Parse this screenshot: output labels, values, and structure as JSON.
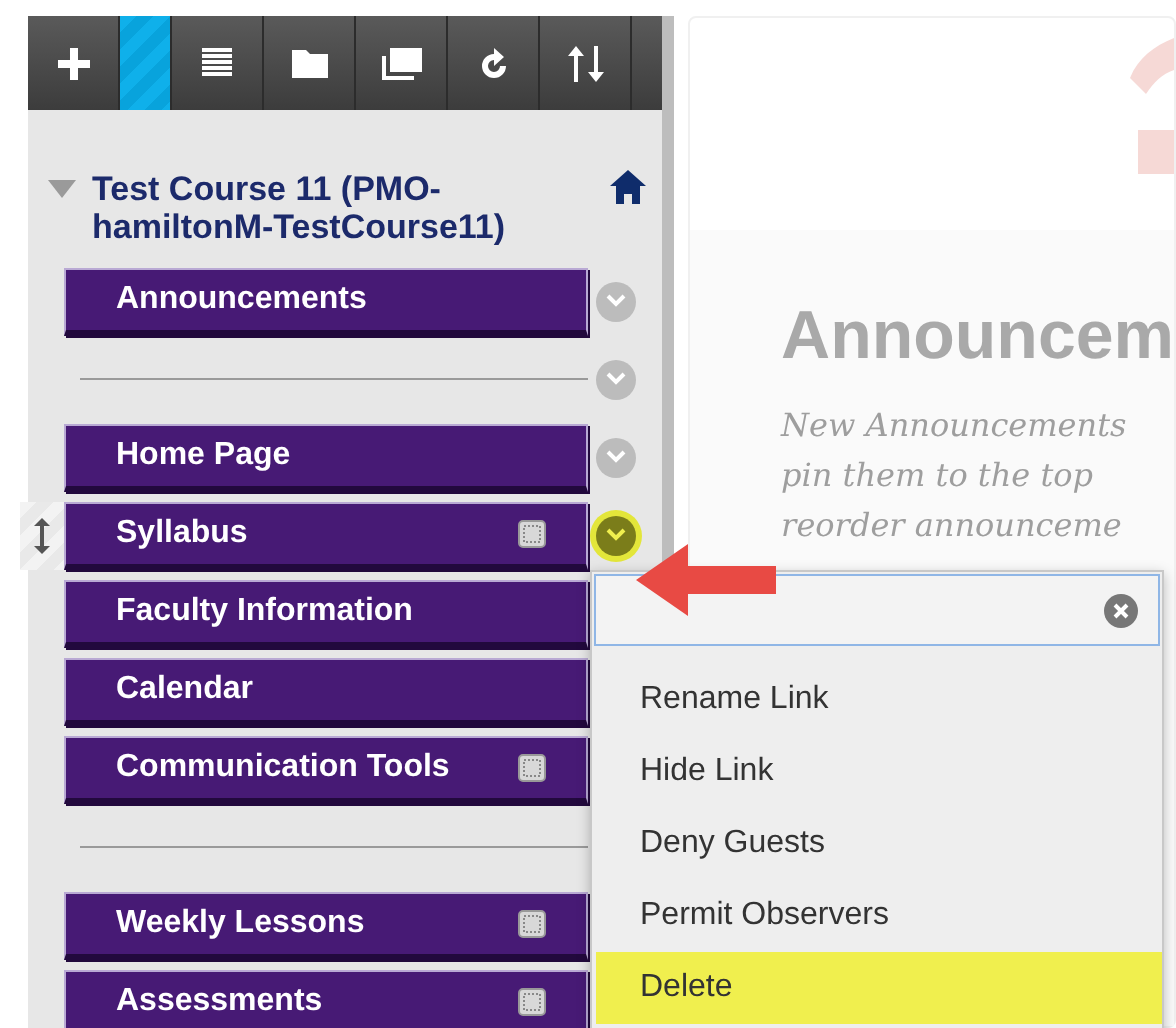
{
  "toolbar": [
    {
      "kind": "add",
      "selected": false
    },
    {
      "kind": "blank",
      "selected": true
    },
    {
      "kind": "list",
      "selected": false
    },
    {
      "kind": "folder",
      "selected": false
    },
    {
      "kind": "window",
      "selected": false
    },
    {
      "kind": "refresh",
      "selected": false
    },
    {
      "kind": "sort",
      "selected": false
    }
  ],
  "course": {
    "title": "Test Course 11 (PMO-hamiltonM-TestCourse11)",
    "expanded": true
  },
  "menu": [
    {
      "kind": "link",
      "label": "Announcements",
      "page_icon": false,
      "options_button": true,
      "active": false
    },
    {
      "kind": "divider",
      "options_button": true
    },
    {
      "kind": "link",
      "label": "Home Page",
      "page_icon": false,
      "options_button": true,
      "active": false
    },
    {
      "kind": "link",
      "label": "Syllabus",
      "page_icon": true,
      "options_button": true,
      "active": true
    },
    {
      "kind": "link",
      "label": "Faculty Information",
      "page_icon": false,
      "options_button": false,
      "active": false
    },
    {
      "kind": "link",
      "label": "Calendar",
      "page_icon": false,
      "options_button": false,
      "active": false
    },
    {
      "kind": "link",
      "label": "Communication Tools",
      "page_icon": true,
      "options_button": false,
      "active": false
    },
    {
      "kind": "divider",
      "options_button": false
    },
    {
      "kind": "link",
      "label": "Weekly Lessons",
      "page_icon": true,
      "options_button": false,
      "active": false
    },
    {
      "kind": "link",
      "label": "Assessments",
      "page_icon": true,
      "options_button": false,
      "active": false
    }
  ],
  "context_menu": {
    "items": [
      {
        "label": "Rename Link",
        "highlighted": false
      },
      {
        "label": "Hide Link",
        "highlighted": false
      },
      {
        "label": "Deny Guests",
        "highlighted": false
      },
      {
        "label": "Permit Observers",
        "highlighted": false
      },
      {
        "label": "Delete",
        "highlighted": true
      }
    ]
  },
  "content": {
    "heading": "Announcem",
    "lines": [
      "New Announcements",
      "pin them to the top",
      "reorder announceme"
    ]
  }
}
